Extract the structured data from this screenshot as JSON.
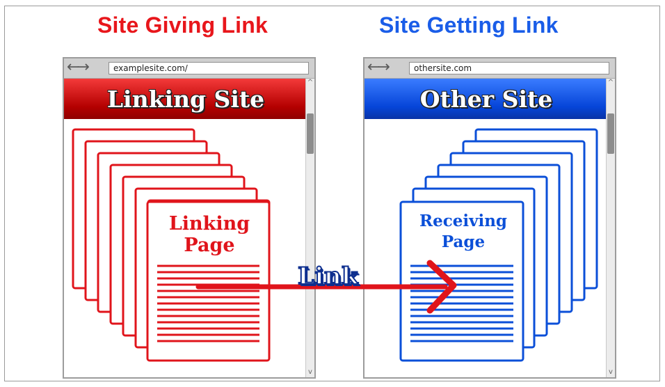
{
  "left": {
    "heading": "Site Giving Link",
    "url": "examplesite.com/",
    "banner": "Linking Site",
    "page_label": [
      "Linking",
      "Page"
    ]
  },
  "right": {
    "heading": "Site Getting Link",
    "url": "othersite.com",
    "banner": "Other Site",
    "page_label": [
      "Receiving",
      "Page"
    ]
  },
  "link_label": "Link",
  "colors": {
    "giving": "#e0141b",
    "getting": "#0b4fd8",
    "link_text_outline": "#0e2f8f"
  },
  "icons": {
    "nav": "back-forward-arrows-icon",
    "arrow": "right-arrow-icon"
  }
}
